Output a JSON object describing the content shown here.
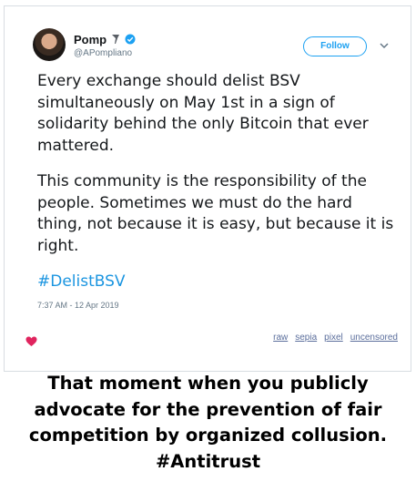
{
  "tweet": {
    "author_name": "Pomp",
    "author_handle": "@APompliano",
    "follow_label": "Follow",
    "paragraph1": "Every exchange should delist BSV simultaneously on May 1st in a sign of solidarity behind the only Bitcoin that ever mattered.",
    "paragraph2": "This community is the responsibility of the people. Sometimes we must do the hard thing, not because it is easy, but because it is right.",
    "hashtag": "#DelistBSV",
    "timestamp": "7:37 AM - 12 Apr 2019",
    "heart_icon": "heart-icon",
    "links": [
      "raw",
      "sepia",
      "pixel",
      "uncensored"
    ]
  },
  "caption": {
    "line1": "That moment when you publicly",
    "line2": "advocate for the prevention of fair",
    "line3": "competition by organized collusion.",
    "line4": "#Antitrust"
  },
  "colors": {
    "accent": "#1da1f2",
    "hashtag": "#1b95e0",
    "heart": "#e0245e",
    "link": "#5b6e9c"
  }
}
